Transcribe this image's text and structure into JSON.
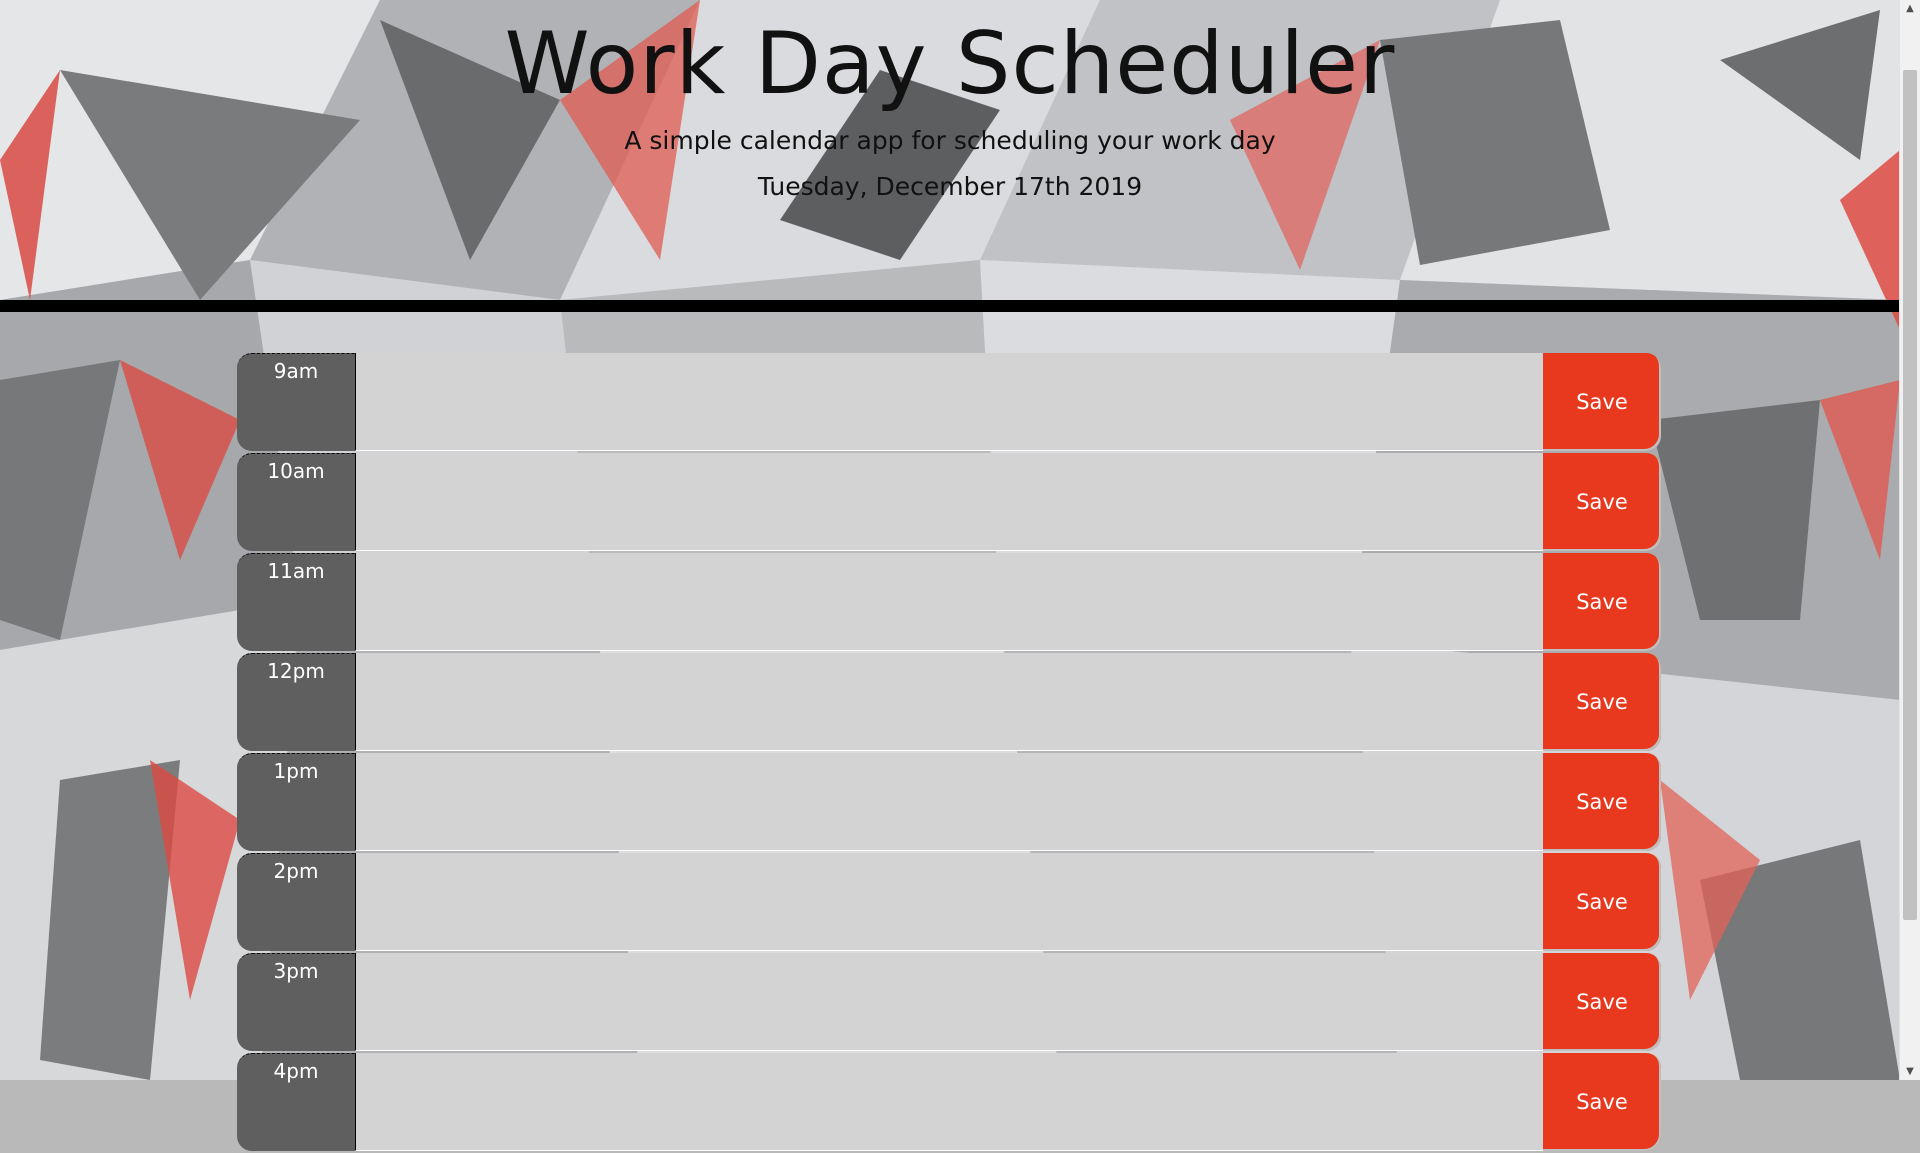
{
  "header": {
    "title": "Work Day Scheduler",
    "subtitle": "A simple calendar app for scheduling your work day",
    "date": "Tuesday, December 17th 2019"
  },
  "rows": [
    {
      "hour": "9am",
      "text": "",
      "save_label": "Save"
    },
    {
      "hour": "10am",
      "text": "",
      "save_label": "Save"
    },
    {
      "hour": "11am",
      "text": "",
      "save_label": "Save"
    },
    {
      "hour": "12pm",
      "text": "",
      "save_label": "Save"
    },
    {
      "hour": "1pm",
      "text": "",
      "save_label": "Save"
    },
    {
      "hour": "2pm",
      "text": "",
      "save_label": "Save"
    },
    {
      "hour": "3pm",
      "text": "",
      "save_label": "Save"
    },
    {
      "hour": "4pm",
      "text": "",
      "save_label": "Save"
    }
  ],
  "colors": {
    "hour_block": "#5f5f5f",
    "description": "#d3d3d3",
    "save_button": "#e8391e",
    "divider": "#000000"
  },
  "icons": {
    "scroll_up": "scroll-up-arrow-icon",
    "scroll_down": "scroll-down-arrow-icon"
  }
}
